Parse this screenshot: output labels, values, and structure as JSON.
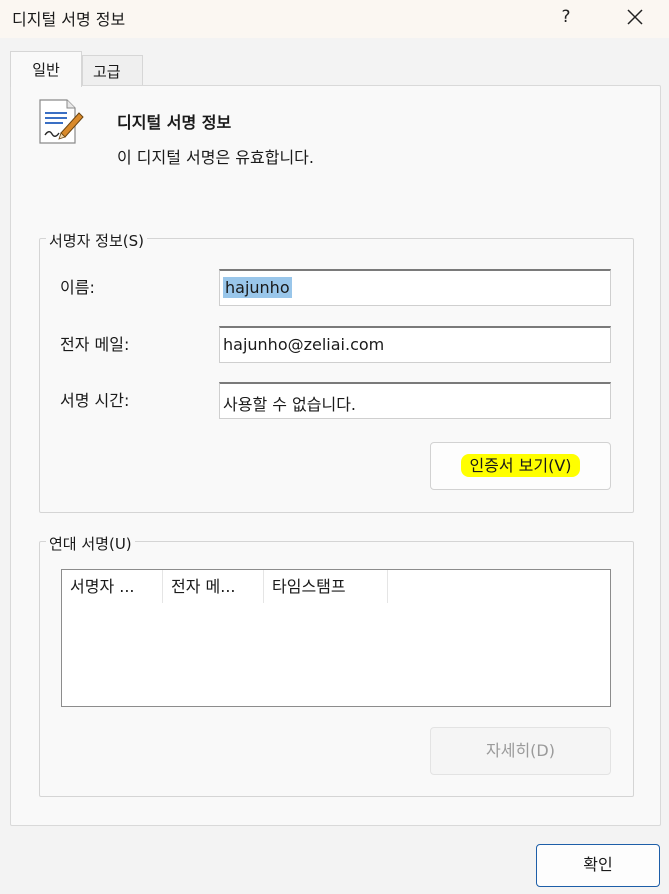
{
  "window": {
    "title": "디지털 서명 정보",
    "help_label": "?"
  },
  "tabs": [
    {
      "label": "일반",
      "active": true
    },
    {
      "label": "고급",
      "active": false
    }
  ],
  "info": {
    "icon": "certificate-icon",
    "heading": "디지털 서명 정보",
    "status": "이 디지털 서명은 유효합니다."
  },
  "signer_info": {
    "group_label": "서명자 정보(S)",
    "fields": [
      {
        "label": "이름:",
        "value": "hajunho"
      },
      {
        "label": "전자 메일:",
        "value": "hajunho@zeliai.com"
      },
      {
        "label": "서명 시간:",
        "value": "사용할 수 없습니다."
      }
    ],
    "view_cert_button": "인증서 보기(V)"
  },
  "countersignatures": {
    "group_label": "연대 서명(U)",
    "columns": [
      "서명자 ...",
      "전자 메...",
      "타임스탬프"
    ],
    "rows": [],
    "details_button": "자세히(D)"
  },
  "footer": {
    "ok_button": "확인"
  },
  "colors": {
    "highlight": "#ffff00",
    "selection": "#99c6ea",
    "ok_border": "#1d5ea8"
  }
}
